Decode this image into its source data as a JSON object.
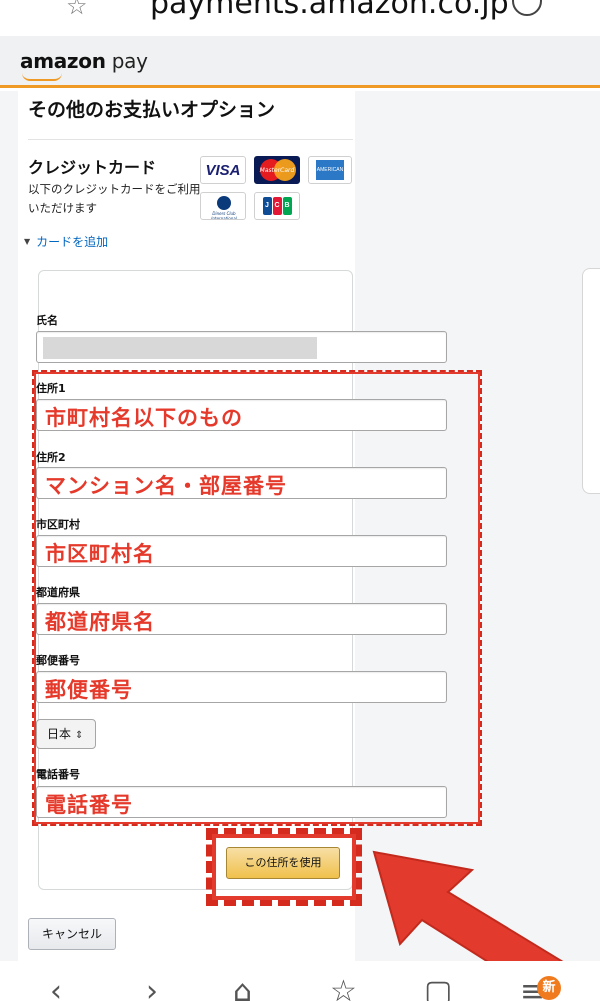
{
  "browser": {
    "url": "payments.amazon.co.jp",
    "badge": "新"
  },
  "header": {
    "logo_amazon": "amazon",
    "logo_pay": "pay"
  },
  "page": {
    "title": "その他のお支払いオプション",
    "credit_card_title": "クレジットカード",
    "credit_card_desc": "以下のクレジットカードをご利用いただけます",
    "card_brands": [
      "VISA",
      "MasterCard",
      "AMERICAN EXPRESS",
      "Diners Club International",
      "JCB"
    ],
    "add_card": "カードを追加"
  },
  "form": {
    "name_label": "氏名",
    "address1_label": "住所1",
    "address1_value": "市町村名以下のもの",
    "address2_label": "住所2",
    "address2_value": "マンション名・部屋番号",
    "city_label": "市区町村",
    "city_value": "市区町村名",
    "prefecture_label": "都道府県",
    "prefecture_value": "都道府県名",
    "postal_label": "郵便番号",
    "postal_value": "郵便番号",
    "country_value": "日本",
    "phone_label": "電話番号",
    "phone_value": "電話番号",
    "use_address_button": "この住所を使用",
    "cancel_button": "キャンセル"
  },
  "colors": {
    "accent_orange": "#f09a26",
    "annotation_red": "#e23a2c",
    "link_blue": "#0066c0"
  }
}
